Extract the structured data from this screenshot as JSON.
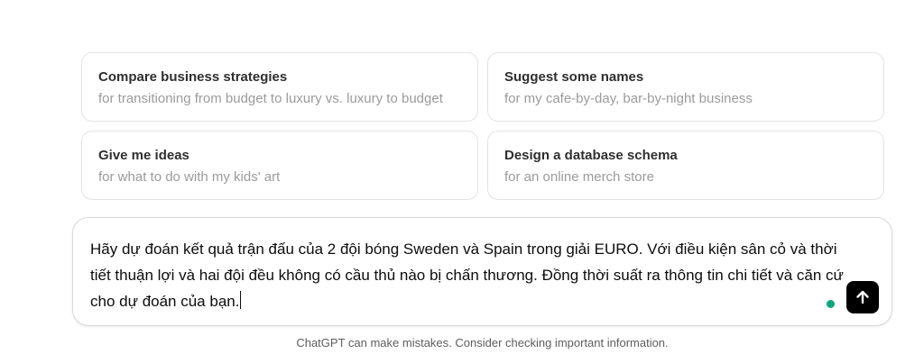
{
  "suggestions": [
    {
      "title": "Compare business strategies",
      "subtitle": "for transitioning from budget to luxury vs. luxury to budget"
    },
    {
      "title": "Suggest some names",
      "subtitle": "for my cafe-by-day, bar-by-night business"
    },
    {
      "title": "Give me ideas",
      "subtitle": "for what to do with my kids' art"
    },
    {
      "title": "Design a database schema",
      "subtitle": "for an online merch store"
    }
  ],
  "composer": {
    "value": "Hãy dự đoán kết quả trận đấu của 2 đội bóng Sweden và Spain trong giải EURO. Với điều kiện sân cỏ và thời tiết thuận lợi và hai đội đều không có cầu thủ nào bị chấn thương. Đồng thời suất ra thông tin chi tiết và căn cứ cho dự đoán của bạn.",
    "send_icon": "arrow-up-icon"
  },
  "footer": {
    "disclaimer": "ChatGPT can make mistakes. Consider checking important information."
  },
  "colors": {
    "status_dot": "#10a37f",
    "send_button_bg": "#000000"
  }
}
